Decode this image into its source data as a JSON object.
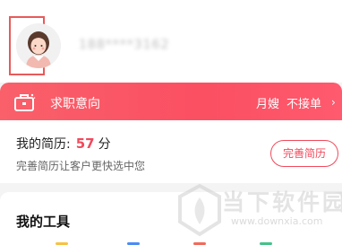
{
  "profile": {
    "avatar_icon": "female-avatar-icon",
    "username": "188****3162"
  },
  "job_intent": {
    "title": "求职意向",
    "role": "月嫂",
    "status": "不接单",
    "chevron": "›"
  },
  "resume": {
    "prefix": "我的简历:",
    "score": "57",
    "unit": "分",
    "hint": "完善简历让客户更快选中您",
    "button_label": "完善简历"
  },
  "tools": {
    "title": "我的工具"
  },
  "watermark": {
    "title": "当下软件园",
    "url": "www.downxia.com"
  },
  "colors": {
    "accent": "#f14a5c",
    "banner_start": "#f9606a",
    "banner_end": "#ff5a6e"
  }
}
